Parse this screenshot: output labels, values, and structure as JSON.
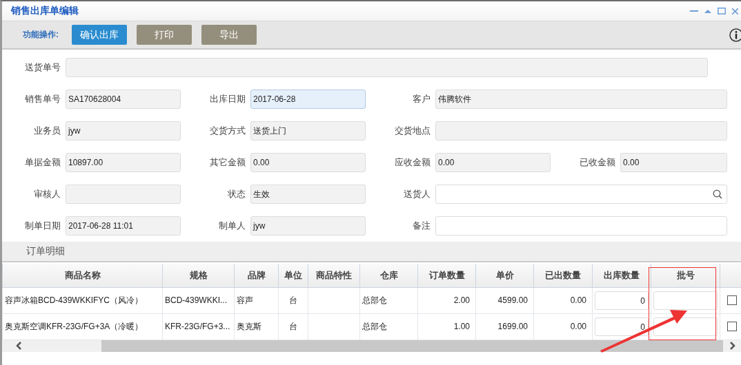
{
  "window": {
    "title": "销售出库单编辑"
  },
  "toolbar": {
    "label": "功能操作:",
    "buttons": [
      {
        "label": "确认出库",
        "primary": true
      },
      {
        "label": "打印",
        "primary": false
      },
      {
        "label": "导出",
        "primary": false
      }
    ]
  },
  "form": {
    "rows": [
      [
        {
          "label": "送货单号",
          "editable": false
        }
      ],
      [
        {
          "label": "销售单号",
          "value": "SA170628004",
          "editable": false
        },
        {
          "label": "出库日期",
          "value": "2017-06-28",
          "focused": true
        },
        {
          "label": "客户",
          "value": "伟腾软件",
          "editable": false
        }
      ],
      [
        {
          "label": "业务员",
          "value": "jyw",
          "editable": false
        },
        {
          "label": "交货方式",
          "value": "送货上门",
          "editable": false
        },
        {
          "label": "交货地点",
          "editable": false
        }
      ],
      [
        {
          "label": "单据金额",
          "value": "10897.00",
          "editable": false
        },
        {
          "label": "其它金额",
          "value": "0.00",
          "editable": false
        },
        {
          "label": "应收金额",
          "value": "0.00",
          "editable": false
        },
        {
          "label": "已收金额",
          "value": "0.00",
          "editable": false
        }
      ],
      [
        {
          "label": "审核人",
          "editable": false
        },
        {
          "label": "状态",
          "value": "生效",
          "editable": false
        },
        {
          "label": "送货人",
          "editable": true,
          "kind": "lookup"
        }
      ],
      [
        {
          "label": "制单日期",
          "value": "2017-06-28 11:01",
          "editable": false
        },
        {
          "label": "制单人",
          "value": "jyw",
          "editable": false
        },
        {
          "label": "备注",
          "editable": true
        }
      ]
    ]
  },
  "details": {
    "title": "订单明细",
    "columns": [
      "商品名称",
      "规格",
      "品牌",
      "单位",
      "商品特性",
      "仓库",
      "订单数量",
      "单价",
      "已出数量",
      "出库数量",
      "批号"
    ],
    "rows": [
      {
        "name": "容声冰箱BCD-439WKKIFYC（风冷）",
        "spec": "BCD-439WKKI...",
        "brand": "容声",
        "unit": "台",
        "warehouse": "总部仓",
        "order_qty": "2.00",
        "price": "4599.00",
        "shipped_qty": "0.00",
        "out_qty": "0",
        "checked": false
      },
      {
        "name": "奥克斯空调KFR-23G/FG+3A（冷暖）",
        "spec": "KFR-23G/FG+3...",
        "brand": "奥克斯",
        "unit": "台",
        "warehouse": "总部仓",
        "order_qty": "1.00",
        "price": "1699.00",
        "shipped_qty": "0.00",
        "out_qty": "0",
        "checked": false
      }
    ]
  }
}
